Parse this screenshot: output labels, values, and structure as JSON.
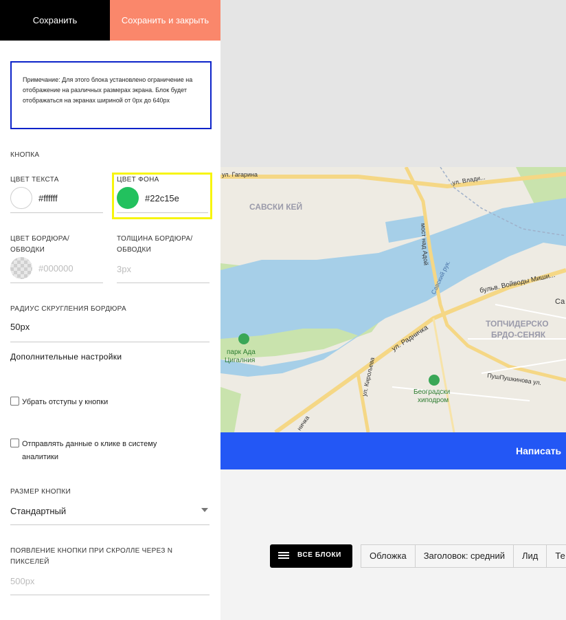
{
  "toolbar": {
    "save_label": "Сохранить",
    "save_close_label": "Сохранить и закрыть"
  },
  "note": {
    "text": "Примечание: Для этого блока установлено ограничение на отображение на различных размерах экрана. Блок будет отображаться на экранах шириной от 0px до 640px"
  },
  "button_section": {
    "title": "КНОПКА",
    "text_color": {
      "label": "ЦВЕТ ТЕКСТА",
      "value": "#ffffff",
      "swatch": "#ffffff"
    },
    "bg_color": {
      "label": "ЦВЕТ ФОНА",
      "value": "#22c15e",
      "swatch": "#22c15e"
    },
    "border_color": {
      "label": "ЦВЕТ БОРДЮРА/ ОБВОДКИ",
      "placeholder": "#000000"
    },
    "border_width": {
      "label": "ТОЛЩИНА БОРДЮРА/ ОБВОДКИ",
      "placeholder": "3px"
    },
    "radius": {
      "label": "РАДИУС СКРУГЛЕНИЯ БОРДЮРА",
      "value": "50px"
    },
    "extra_settings": "Дополнительные настройки",
    "remove_padding": "Убрать отступы у кнопки",
    "send_analytics": "Отправлять данные о клике в систему аналитики",
    "size": {
      "label": "РАЗМЕР КНОПКИ",
      "value": "Стандартный"
    },
    "scroll": {
      "label": "ПОЯВЛЕНИЕ КНОПКИ ПРИ СКРОЛЛЕ ЧЕРЕЗ N ПИКСЕЛЕЙ",
      "placeholder": "500px"
    }
  },
  "map": {
    "labels": {
      "gagarina": "ул. Гагарина",
      "vladimira": "ул. Влади...",
      "savski_kej": "САВСКИ КЕЙ",
      "most": "мост над Адой",
      "savski_ruk": "Савский рук.",
      "bulvar": "бульв. Войводы Миши...",
      "sa": "Са",
      "topcider_1": "ТОПЧИДЕРСКО",
      "topcider_2": "БРДО-СЕНЯК",
      "park_1": "парк Ада",
      "park_2": "Цигалния",
      "radnichka": "ул. Радничка",
      "kirovljeva": "ул. Кирољева",
      "pushkinova": "ПушПушкинова ул.",
      "hippo_1": "Београдски",
      "hippo_2": "хиподром",
      "nichka": "ничка"
    }
  },
  "cta": {
    "label": "Написать"
  },
  "bottom_bar": {
    "all_blocks": "ВСЕ БЛОКИ",
    "tabs": [
      "Обложка",
      "Заголовок: средний",
      "Лид",
      "Те"
    ]
  }
}
